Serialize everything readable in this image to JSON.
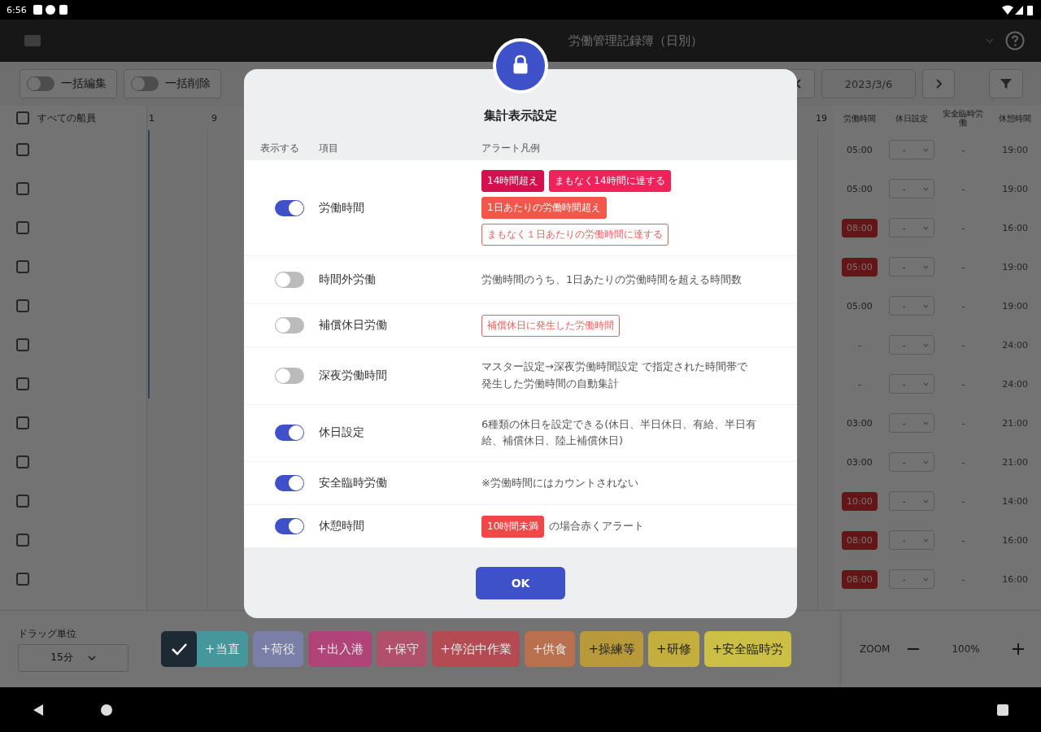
{
  "status_bar": {
    "time": "6:56"
  },
  "app_bar": {
    "title": "労働管理記録簿（日別）"
  },
  "toolbar": {
    "toggles": [
      {
        "label": "一括編集",
        "on": false
      },
      {
        "label": "一括削除",
        "on": false
      }
    ],
    "date": "2023/3/6"
  },
  "table": {
    "select_all": {
      "label": "すべての船員",
      "checked": false
    },
    "hours": [
      "1",
      "9",
      "19"
    ],
    "columns": [
      "労働時間",
      "休日設定",
      "安全臨時労働",
      "休憩時間"
    ],
    "rows": [
      {
        "checked": false,
        "work": "05:00",
        "alert": false,
        "holiday": "-",
        "safety": "-",
        "rest": "19:00"
      },
      {
        "checked": false,
        "work": "05:00",
        "alert": false,
        "holiday": "-",
        "safety": "-",
        "rest": "19:00"
      },
      {
        "checked": false,
        "work": "08:00",
        "alert": true,
        "holiday": "-",
        "safety": "-",
        "rest": "16:00"
      },
      {
        "checked": false,
        "work": "05:00",
        "alert": true,
        "holiday": "-",
        "safety": "-",
        "rest": "19:00"
      },
      {
        "checked": false,
        "work": "05:00",
        "alert": false,
        "holiday": "-",
        "safety": "-",
        "rest": "19:00"
      },
      {
        "checked": false,
        "work": "-",
        "alert": false,
        "holiday": "-",
        "safety": "-",
        "rest": "24:00"
      },
      {
        "checked": false,
        "work": "-",
        "alert": false,
        "holiday": "-",
        "safety": "-",
        "rest": "24:00"
      },
      {
        "checked": false,
        "work": "03:00",
        "alert": false,
        "holiday": "-",
        "safety": "-",
        "rest": "21:00"
      },
      {
        "checked": false,
        "work": "03:00",
        "alert": false,
        "holiday": "-",
        "safety": "-",
        "rest": "21:00"
      },
      {
        "checked": false,
        "work": "10:00",
        "alert": true,
        "holiday": "-",
        "safety": "-",
        "rest": "14:00"
      },
      {
        "checked": false,
        "work": "08:00",
        "alert": true,
        "holiday": "-",
        "safety": "-",
        "rest": "16:00"
      },
      {
        "checked": false,
        "work": "08:00",
        "alert": true,
        "holiday": "-",
        "safety": "-",
        "rest": "16:00"
      }
    ]
  },
  "bottom_bar": {
    "drag_unit_label": "ドラッグ単位",
    "drag_unit": "15分",
    "tasks": [
      {
        "label": "+当直",
        "color": "#46979c",
        "selected": true,
        "dark_text": false
      },
      {
        "label": "+荷役",
        "color": "#7a7fa8",
        "selected": false,
        "dark_text": false
      },
      {
        "label": "+出入港",
        "color": "#b04478",
        "selected": false,
        "dark_text": false
      },
      {
        "label": "+保守",
        "color": "#b0506a",
        "selected": false,
        "dark_text": false
      },
      {
        "label": "+停泊中作業",
        "color": "#b44a52",
        "selected": false,
        "dark_text": false
      },
      {
        "label": "+供食",
        "color": "#b8704e",
        "selected": false,
        "dark_text": false
      },
      {
        "label": "+操練等",
        "color": "#b89a3a",
        "selected": false,
        "dark_text": true
      },
      {
        "label": "+研修",
        "color": "#c4ae3e",
        "selected": false,
        "dark_text": true
      },
      {
        "label": "+安全臨時労",
        "color": "#cbbf46",
        "selected": false,
        "dark_text": true
      }
    ],
    "zoom": {
      "label": "ZOOM",
      "value": "100%"
    }
  },
  "dialog": {
    "title": "集計表示設定",
    "headers": [
      "表示する",
      "項目",
      "アラート凡例"
    ],
    "rows": [
      {
        "on": true,
        "label": "労働時間",
        "legend": [
          {
            "kind": "badge",
            "text": "14時間超え",
            "color": "#d4104e",
            "outline": false
          },
          {
            "kind": "badge",
            "text": "まもなく14時間に達する",
            "color": "#f0225a",
            "outline": false
          },
          {
            "kind": "badge",
            "text": "1日あたりの労働時間超え",
            "color": "#f2574a",
            "outline": false
          },
          {
            "kind": "badge",
            "text": "まもなく１日あたりの労働時間に達する",
            "color": "#f25c5c",
            "outline": true
          }
        ]
      },
      {
        "on": false,
        "label": "時間外労働",
        "legend": [
          {
            "kind": "text",
            "text": "労働時間のうち、1日あたりの労働時間を超える時間数"
          }
        ]
      },
      {
        "on": false,
        "label": "補償休日労働",
        "legend": [
          {
            "kind": "badge",
            "text": "補償休日に発生した労働時間",
            "color": "#f25c5c",
            "outline": true
          }
        ]
      },
      {
        "on": false,
        "label": "深夜労働時間",
        "legend": [
          {
            "kind": "text",
            "text": "マスター設定→深夜労働時間設定 で指定された時間帯で発生した労働時間の自動集計"
          }
        ]
      },
      {
        "on": true,
        "label": "休日設定",
        "legend": [
          {
            "kind": "text",
            "text": "6種類の休日を設定できる(休日、半日休日、有給、半日有給、補償休日、陸上補償休日)"
          }
        ]
      },
      {
        "on": true,
        "label": "安全臨時労働",
        "legend": [
          {
            "kind": "text",
            "text": "※労働時間にはカウントされない"
          }
        ]
      },
      {
        "on": true,
        "label": "休憩時間",
        "legend": [
          {
            "kind": "badge",
            "text": "10時間未満",
            "color": "#f04848",
            "outline": false
          },
          {
            "kind": "text",
            "text": "の場合赤くアラート"
          }
        ]
      }
    ],
    "ok": "OK"
  }
}
